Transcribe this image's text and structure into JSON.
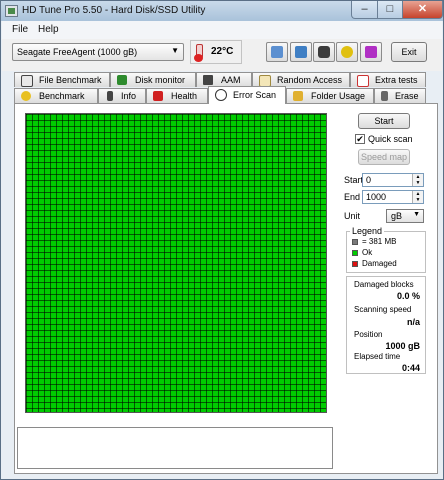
{
  "window": {
    "title": "HD Tune Pro 5.50 - Hard Disk/SSD Utility"
  },
  "titlebar": {
    "min": "–",
    "max": "□",
    "close": "✕"
  },
  "menu": {
    "file": "File",
    "help": "Help"
  },
  "toolbar": {
    "drive": "Seagate FreeAgent (1000 gB)",
    "temperature": "22°C",
    "exit": "Exit"
  },
  "tabs_top": [
    "File Benchmark",
    "Disk monitor",
    "AAM",
    "Random Access",
    "Extra tests"
  ],
  "tabs_bottom": [
    "Benchmark",
    "Info",
    "Health",
    "Error Scan",
    "Folder Usage",
    "Erase"
  ],
  "active_tab": "Error Scan",
  "scan": {
    "start_button": "Start",
    "quick_scan_label": "Quick scan",
    "quick_scan_checked": true,
    "speed_map_button": "Speed map",
    "start_label": "Start",
    "start_value": "0",
    "end_label": "End",
    "end_value": "1000",
    "unit_label": "Unit",
    "unit_value": "gB"
  },
  "legend": {
    "title": "Legend",
    "block_size": "= 381 MB",
    "ok": "Ok",
    "damaged": "Damaged",
    "colors": {
      "block": "#7a7a7a",
      "ok": "#00cc00",
      "damaged": "#dd1111"
    }
  },
  "stats": {
    "damaged_label": "Damaged blocks",
    "damaged_value": "0.0 %",
    "speed_label": "Scanning speed",
    "speed_value": "n/a",
    "position_label": "Position",
    "position_value": "1000 gB",
    "elapsed_label": "Elapsed time",
    "elapsed_value": "0:44"
  },
  "status_text": "",
  "colors": {
    "grid_ok": "#00cc00"
  }
}
